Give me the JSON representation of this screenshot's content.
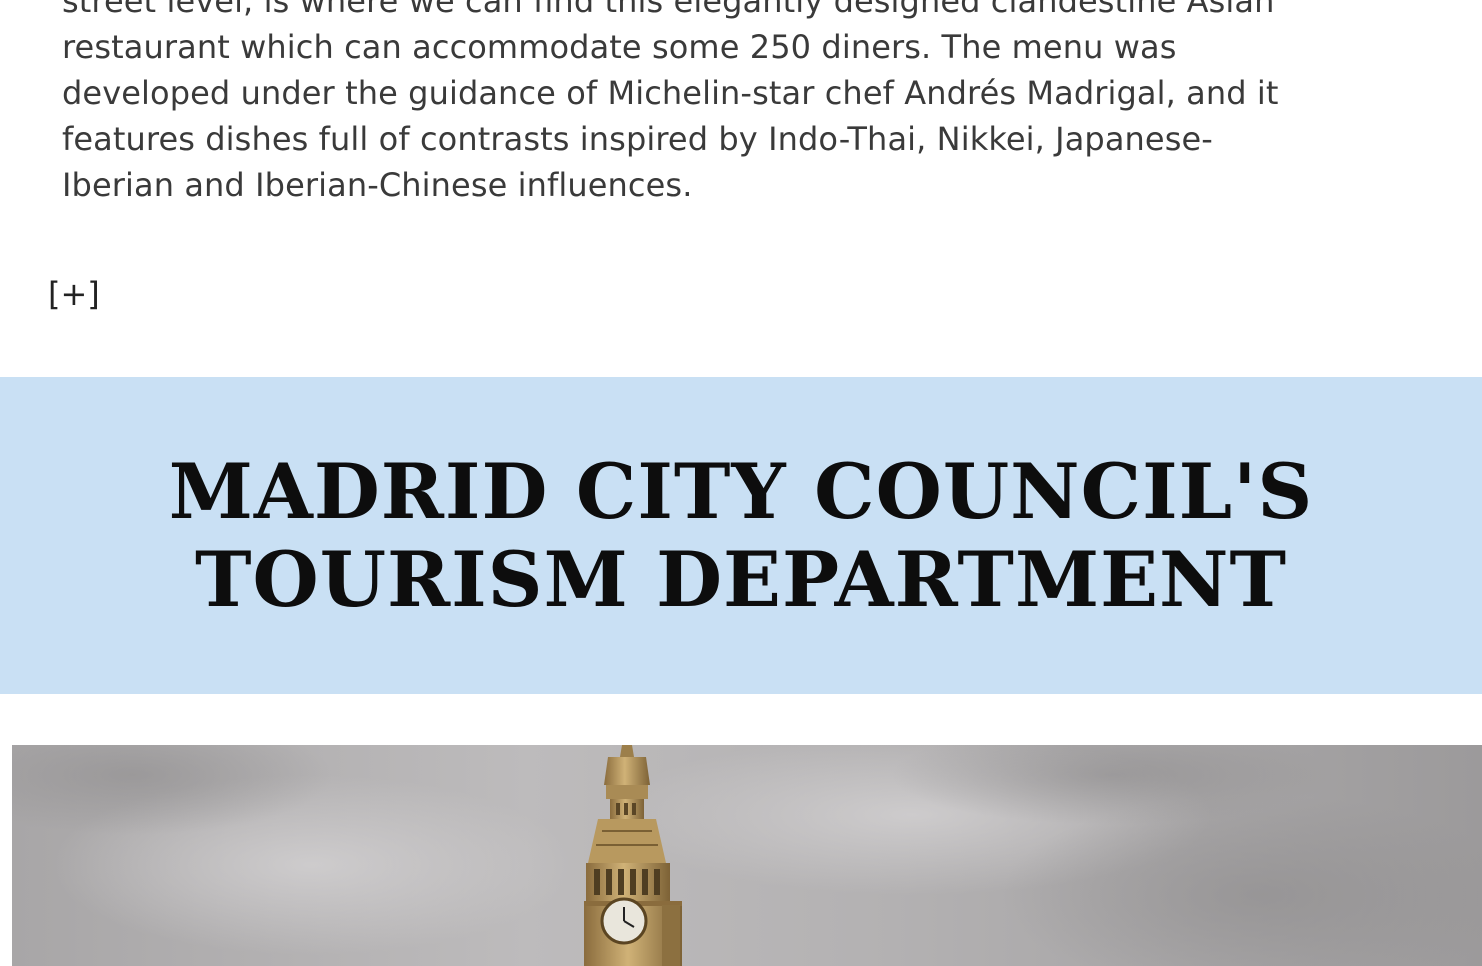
{
  "article": {
    "lines": [
      "street level, is where we can find this elegantly designed clandestine Asian",
      "restaurant which can accommodate some 250 diners. The menu was",
      "developed under the guidance of Michelin-star chef Andrés Madrigal, and it",
      "features dishes full of contrasts inspired by Indo-Thai, Nikkei, Japanese-",
      "Iberian and Iberian-Chinese influences."
    ],
    "expand_label": "[+]"
  },
  "banner": {
    "title_lines": [
      "MADRID CITY COUNCIL'S",
      "TOURISM DEPARTMENT"
    ],
    "background": "#c9e0f4"
  },
  "photo": {
    "subject": "big-ben-clock-tower",
    "sky_color": "#a9a7a8",
    "stone_color": "#c4a46a"
  }
}
